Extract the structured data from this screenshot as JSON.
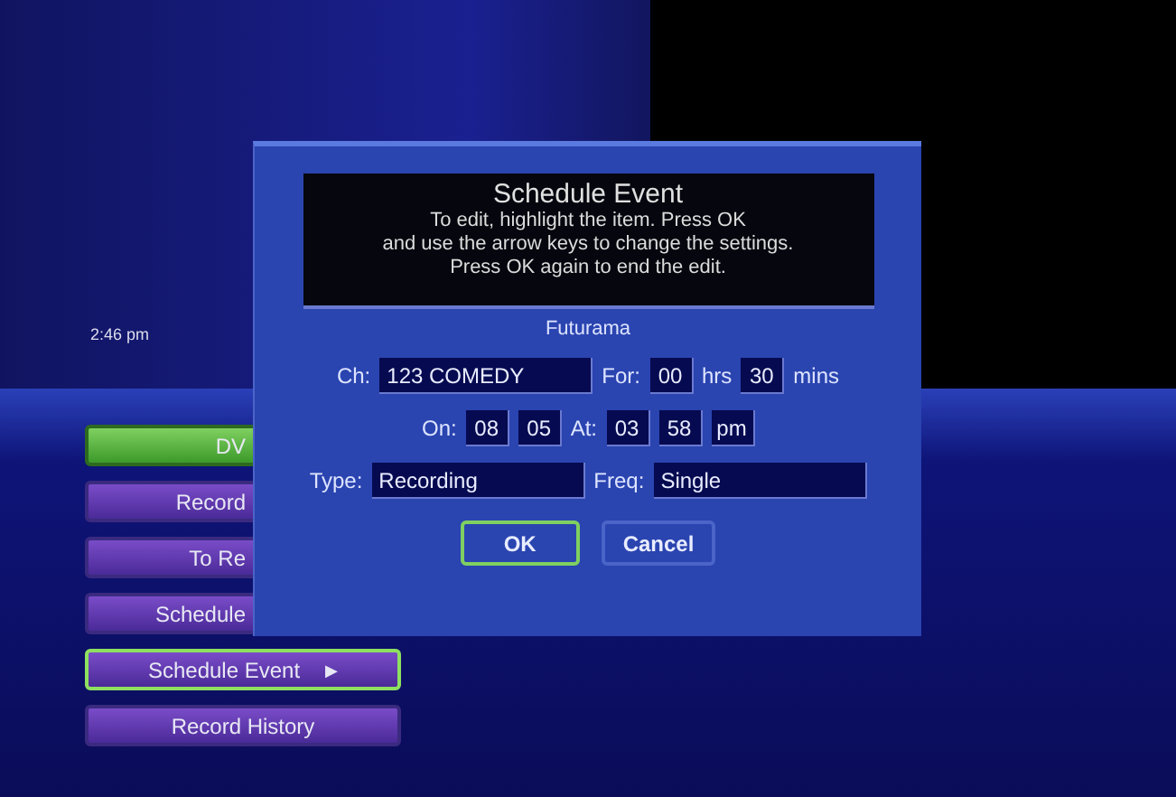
{
  "clock": "2:46 pm",
  "menu": [
    {
      "label": "DV",
      "kind": "covered",
      "selected": true,
      "focused": false
    },
    {
      "label": "Record",
      "kind": "covered",
      "selected": false,
      "focused": false
    },
    {
      "label": "To Re",
      "kind": "covered",
      "selected": false,
      "focused": false
    },
    {
      "label": "Schedule",
      "kind": "covered",
      "selected": false,
      "focused": false
    },
    {
      "label": "Schedule Event",
      "kind": "full",
      "selected": false,
      "focused": true,
      "arrow": "▶"
    },
    {
      "label": "Record History",
      "kind": "full",
      "selected": false,
      "focused": false
    }
  ],
  "dialog": {
    "title": "Schedule Event",
    "instructions": [
      "To edit, highlight the item. Press OK",
      "and use the arrow keys to change the settings.",
      "Press OK again to end the edit."
    ],
    "program": "Futurama",
    "field_lines": [
      {
        "items": [
          {
            "kind": "label",
            "text": "Ch:"
          },
          {
            "kind": "wide",
            "text": "123 COMEDY"
          },
          {
            "kind": "label",
            "text": "For:"
          },
          {
            "kind": "small",
            "text": "00"
          },
          {
            "kind": "label",
            "text": "hrs"
          },
          {
            "kind": "small",
            "text": "30"
          },
          {
            "kind": "label",
            "text": "mins"
          }
        ]
      },
      {
        "items": [
          {
            "kind": "label",
            "text": "On:"
          },
          {
            "kind": "small",
            "text": "08"
          },
          {
            "kind": "small",
            "text": "05"
          },
          {
            "kind": "label",
            "text": "At:"
          },
          {
            "kind": "small",
            "text": "03"
          },
          {
            "kind": "small",
            "text": "58"
          },
          {
            "kind": "small",
            "text": "pm"
          }
        ]
      },
      {
        "items": [
          {
            "kind": "label",
            "text": "Type:"
          },
          {
            "kind": "wide",
            "text": "Recording"
          },
          {
            "kind": "label",
            "text": "Freq:"
          },
          {
            "kind": "wide",
            "text": "Single"
          }
        ]
      }
    ],
    "buttons": [
      {
        "label": "OK",
        "focused": true
      },
      {
        "label": "Cancel",
        "focused": false
      }
    ]
  }
}
